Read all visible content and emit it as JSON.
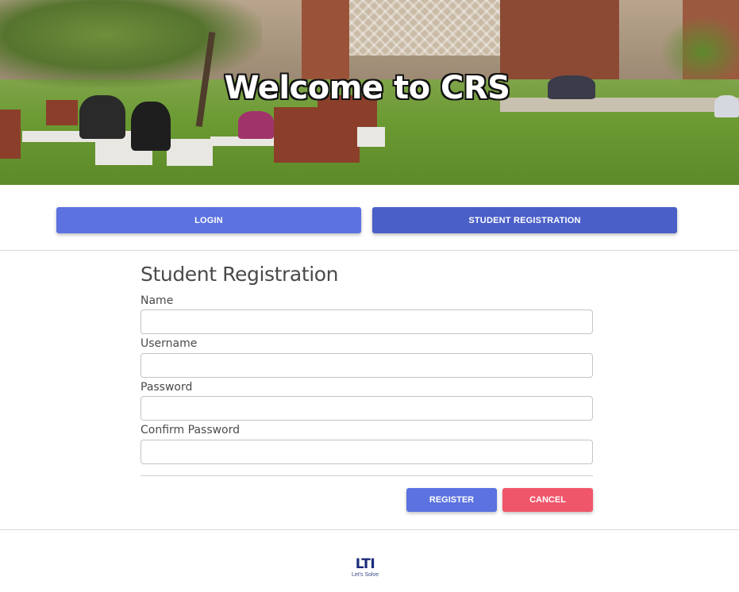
{
  "hero": {
    "title": "Welcome to CRS"
  },
  "nav": {
    "login_label": "LOGIN",
    "registration_label": "STUDENT REGISTRATION"
  },
  "form": {
    "title": "Student Registration",
    "fields": [
      {
        "label": "Name",
        "value": "",
        "placeholder": ""
      },
      {
        "label": "Username",
        "value": "",
        "placeholder": ""
      },
      {
        "label": "Password",
        "value": "",
        "placeholder": ""
      },
      {
        "label": "Confirm Password",
        "value": "",
        "placeholder": ""
      }
    ],
    "register_label": "REGISTER",
    "cancel_label": "CANCEL"
  },
  "footer": {
    "logo_text": "LTI",
    "logo_tagline": "Let's Solve"
  },
  "colors": {
    "primary": "#5b72e0",
    "primary_active": "#4a5fc8",
    "danger": "#f0566a",
    "logo": "#1b2a7a"
  }
}
